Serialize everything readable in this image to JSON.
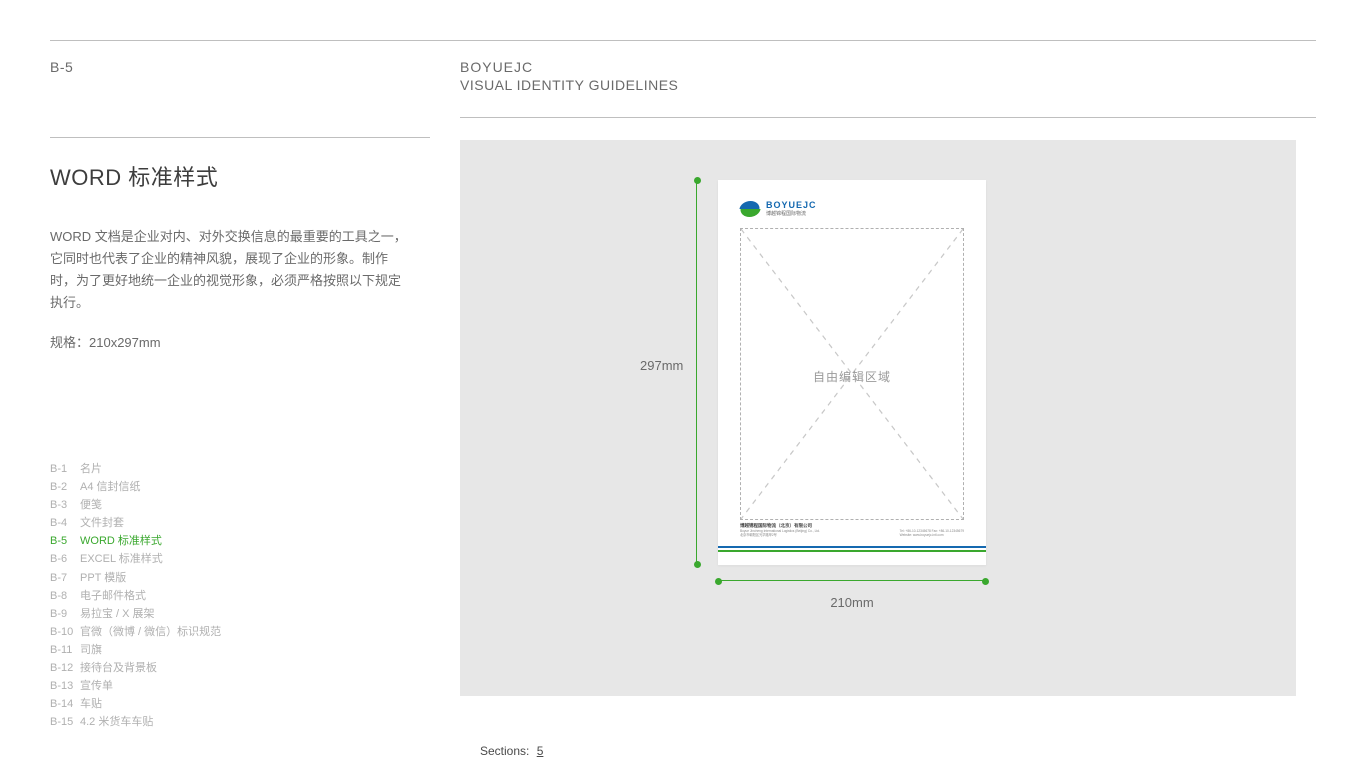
{
  "header": {
    "page_code": "B-5",
    "brand_line1": "BOYUEJC",
    "brand_line2": "VISUAL IDENTITY GUIDELINES"
  },
  "left": {
    "title": "WORD 标准样式",
    "body": "WORD 文档是企业对内、对外交换信息的最重要的工具之一，它同时也代表了企业的精神风貌，展现了企业的形象。制作时，为了更好地统一企业的视觉形象，必须严格按照以下规定执行。",
    "spec": "规格：210x297mm"
  },
  "toc": [
    {
      "code": "B-1",
      "label": "名片"
    },
    {
      "code": "B-2",
      "label": "A4 信封信纸"
    },
    {
      "code": "B-3",
      "label": "便笺"
    },
    {
      "code": "B-4",
      "label": "文件封套"
    },
    {
      "code": "B-5",
      "label": "WORD 标准样式"
    },
    {
      "code": "B-6",
      "label": "EXCEL 标准样式"
    },
    {
      "code": "B-7",
      "label": "PPT 模版"
    },
    {
      "code": "B-8",
      "label": "电子邮件格式"
    },
    {
      "code": "B-9",
      "label": "易拉宝 / X 展架"
    },
    {
      "code": "B-10",
      "label": "官微（微博 / 微信）标识规范"
    },
    {
      "code": "B-11",
      "label": "司旗"
    },
    {
      "code": "B-12",
      "label": "接待台及背景板"
    },
    {
      "code": "B-13",
      "label": "宣传单"
    },
    {
      "code": "B-14",
      "label": "车贴"
    },
    {
      "code": "B-15",
      "label": "4.2 米货车车贴"
    }
  ],
  "toc_active_index": 4,
  "canvas": {
    "dim_height_label": "297mm",
    "dim_width_label": "210mm",
    "logo_text_top": "BOYUEJC",
    "logo_text_bottom": "博越锦程国际物流",
    "edit_area_label": "自由编辑区域",
    "footer_left_line1": "博越锦程国际物流（北京）有限公司",
    "footer_left_line2": "Boyue Jincheng International Logistics (Beijing) Co., Ltd.",
    "footer_left_line3": "北京市朝阳区光华路甲2号",
    "footer_right_line1": "Tel: +86-10-12345678   Fax: +86-10-12345679",
    "footer_right_line2": "Website: www.boyuejc-intl.com"
  },
  "sections": {
    "label": "Sections:",
    "value": "5"
  }
}
